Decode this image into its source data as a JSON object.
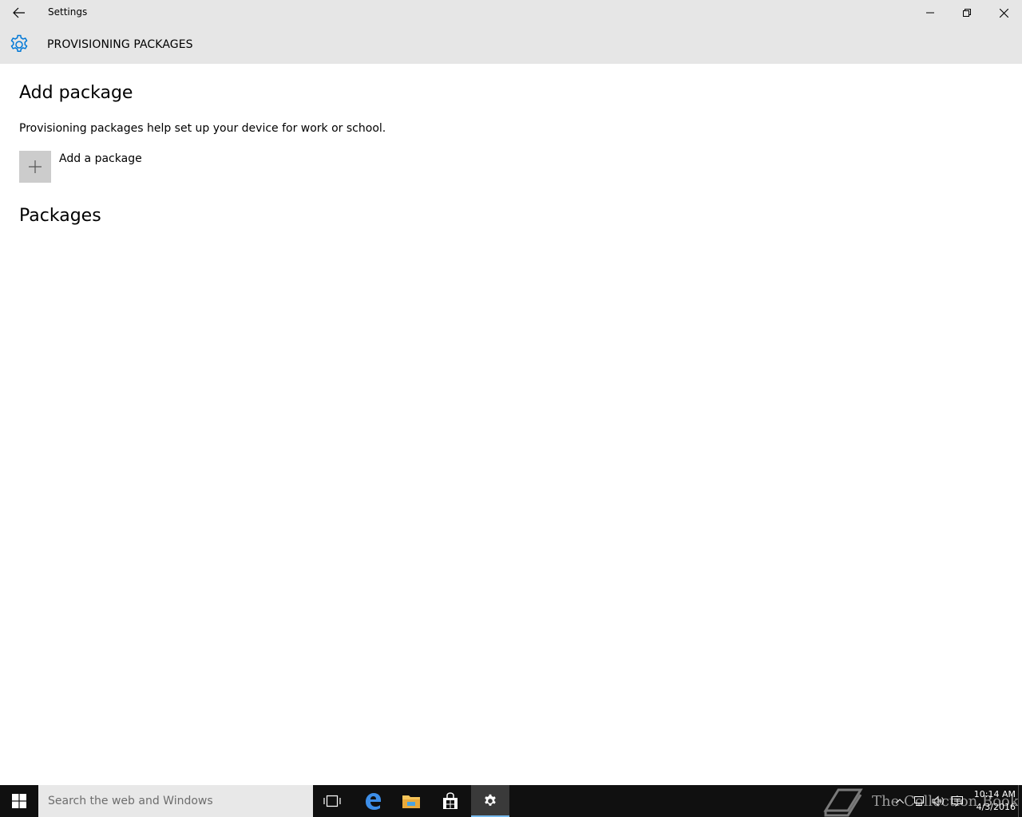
{
  "window": {
    "title": "Settings"
  },
  "header": {
    "title": "PROVISIONING PACKAGES",
    "icon": "gear-icon"
  },
  "content": {
    "add_heading": "Add package",
    "description": "Provisioning packages help set up your device for work or school.",
    "add_button_label": "Add a package",
    "packages_heading": "Packages"
  },
  "taskbar": {
    "search_placeholder": "Search the web and Windows",
    "pinned": [
      "task-view-icon",
      "edge-icon",
      "file-explorer-icon",
      "store-icon",
      "settings-icon"
    ],
    "watermark_text": "The Collection Book",
    "clock_time": "10:14 AM",
    "clock_date": "4/3/2016"
  },
  "colors": {
    "accent": "#0078d7",
    "titlebar": "#e6e6e6",
    "taskbar": "#101010",
    "search_box": "#e8e8e8",
    "add_tile": "#cccccc"
  }
}
